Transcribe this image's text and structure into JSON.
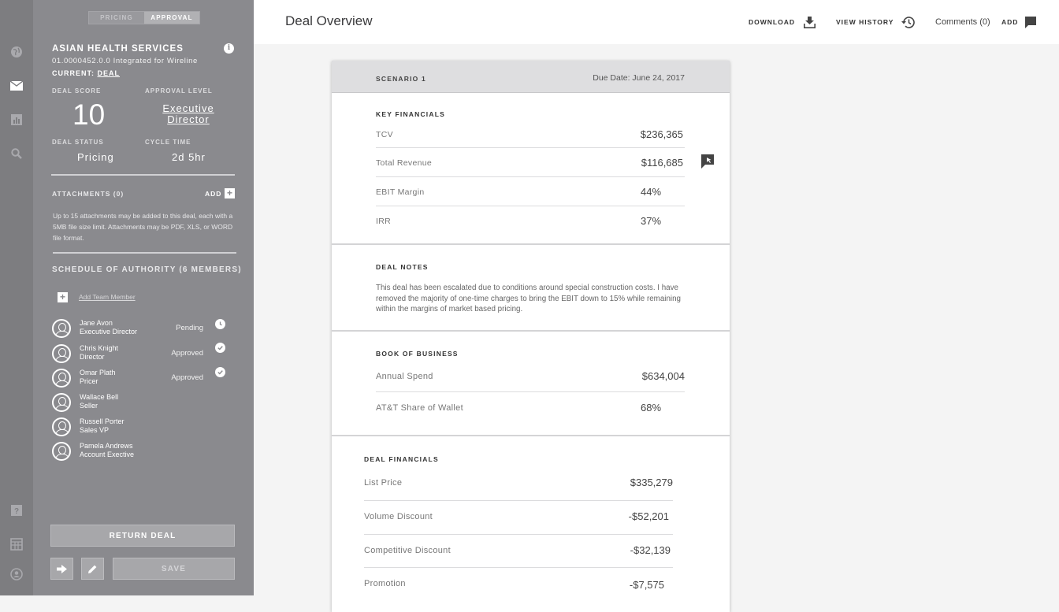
{
  "sidebar": {
    "tabs": [
      {
        "label": "PRICING"
      },
      {
        "label": "APPROVAL"
      }
    ],
    "account": {
      "name": "ASIAN HEALTH SERVICES",
      "subtitle": "01.0000452.0.0 Integrated for Wireline",
      "current_label": "CURRENT:",
      "current_value": "DEAL"
    },
    "deal_score_label": "DEAL SCORE",
    "deal_score": "10",
    "approval_level_label": "APPROVAL LEVEL",
    "approval_level": "Executive Director",
    "deal_status_label": "DEAL STATUS",
    "deal_status": "Pricing",
    "cycle_time_label": "CYCLE TIME",
    "cycle_time": "2d 5hr",
    "attachments_label": "ATTACHMENTS (0)",
    "attachments_add": "ADD",
    "attachments_note": "Up to 15 attachments may be added to this deal, each with a 5MB file size limit. Attachments may be PDF, XLS, or WORD file format.",
    "soa_label": "SCHEDULE OF AUTHORITY (6 MEMBERS)",
    "add_member": "Add Team Member",
    "members": [
      {
        "name": "Jane Avon",
        "role": "Executive Director",
        "status": "Pending",
        "icon": "clock-icon"
      },
      {
        "name": "Chris Knight",
        "role": "Director",
        "status": "Approved",
        "icon": "check-icon"
      },
      {
        "name": "Omar Plath",
        "role": "Pricer",
        "status": "Approved",
        "icon": "check-icon"
      },
      {
        "name": "Wallace Bell",
        "role": "Seller",
        "status": "",
        "icon": ""
      },
      {
        "name": "Russell Porter",
        "role": "Sales VP",
        "status": "",
        "icon": ""
      },
      {
        "name": "Pamela Andrews",
        "role": "Account Exective",
        "status": "",
        "icon": ""
      }
    ],
    "return_label": "RETURN DEAL",
    "save_label": "SAVE"
  },
  "rail": {
    "icons": [
      "globe-icon",
      "mail-icon",
      "chart-icon",
      "search-icon",
      "help-icon",
      "calendar-icon",
      "account-icon"
    ]
  },
  "header": {
    "title": "Deal Overview",
    "download": "DOWNLOAD",
    "view_history": "VIEW HISTORY",
    "comments": "Comments (0)",
    "add": "ADD"
  },
  "card": {
    "scenario": "SCENARIO 1",
    "due_date": "Due Date: June 24, 2017",
    "key_financials": {
      "title": "KEY FINANCIALS",
      "rows": [
        {
          "label": "TCV",
          "value": "$236,365"
        },
        {
          "label": "Total Revenue",
          "value": "$116,685"
        },
        {
          "label": "EBIT Margin",
          "value": "44%"
        },
        {
          "label": "IRR",
          "value": "37%"
        }
      ]
    },
    "deal_notes": {
      "title": "DEAL NOTES",
      "text": "This deal has been escalated due to conditions around special construction costs. I have removed the majority of one-time charges to bring the EBIT down to 15% while remaining within the margins of market based pricing."
    },
    "book_of_business": {
      "title": "BOOK OF BUSINESS",
      "rows": [
        {
          "label": "Annual Spend",
          "value": "$634,004"
        },
        {
          "label": "AT&T Share of Wallet",
          "value": "68%"
        }
      ]
    },
    "deal_financials": {
      "title": "DEAL FINANCIALS",
      "rows": [
        {
          "label": "List Price",
          "value": "$335,279"
        },
        {
          "label": "Volume Discount",
          "value": "-$52,201"
        },
        {
          "label": "Competitive Discount",
          "value": "-$32,139"
        },
        {
          "label": "Promotion",
          "value": "-$7,575"
        }
      ]
    }
  }
}
